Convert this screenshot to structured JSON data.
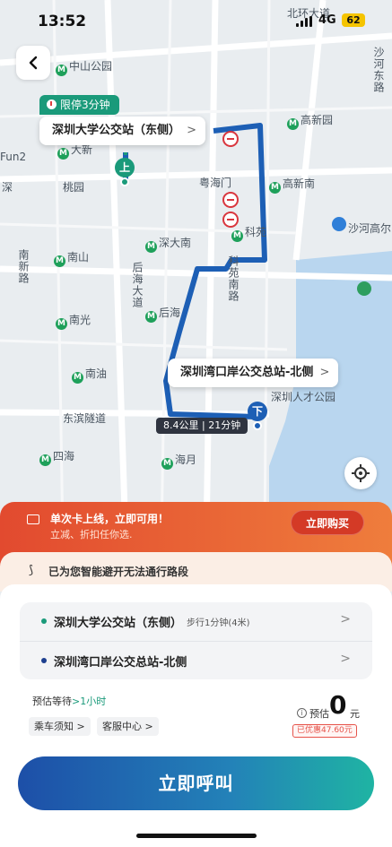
{
  "status_bar": {
    "time": "13:52",
    "network": "4G",
    "battery": "62"
  },
  "map": {
    "labels": {
      "zhongshan_park": "中山公园",
      "beihuan": "北环大道",
      "shahe": "沙河东路",
      "gaoxin": "高新园",
      "gaoxinnan": "高新南",
      "yuehaimen": "粤海门",
      "keyuan": "科苑",
      "shenda_south": "深大南",
      "shahe_gaoer": "沙河高尔",
      "nanxin": "南新路",
      "nanshan": "南山",
      "houhai_ave": "后海大道",
      "keyuan_south": "科苑南路",
      "houhai": "后海",
      "nanguang": "南光",
      "nanyou": "南油",
      "shenzhen_talent": "深圳人才公园",
      "dongbin": "东滨隧道",
      "sihai": "四海",
      "haiyue": "海月",
      "daxin": "大新",
      "taoyuan": "桃园",
      "fun2": "Fun2",
      "shen": "深"
    },
    "stop_tag": "限停3分钟",
    "start_callout": "深圳大学公交站（东侧）",
    "end_callout": "深圳湾口岸公交总站-北侧",
    "start_pin": "上",
    "end_pin": "下",
    "route_info": "8.4公里 | 21分钟",
    "chevron": ">"
  },
  "promo": {
    "title": "单次卡上线，立即可用！",
    "subtitle": "立减、折扣任你选.",
    "button": "立即购买"
  },
  "notice": {
    "text": "已为您智能避开无法通行路段"
  },
  "trip": {
    "start": {
      "name": "深圳大学公交站（东侧）",
      "walk": "步行1分钟(4米)"
    },
    "end": {
      "name": "深圳湾口岸公交总站-北侧"
    },
    "wait_prefix": "预估等待",
    "wait_value": ">1小时",
    "chips": [
      "乘车须知 >",
      "客服中心 >"
    ],
    "price_prefix": "预估",
    "price_value": "0",
    "price_unit": "元",
    "discount": "已优惠47.60元"
  },
  "call_button": "立即呼叫",
  "colors": {
    "accent_green": "#1a9a7a",
    "route_blue": "#1d5fb5",
    "promo_red": "#e24a2f",
    "discount_red": "#e6534a"
  }
}
